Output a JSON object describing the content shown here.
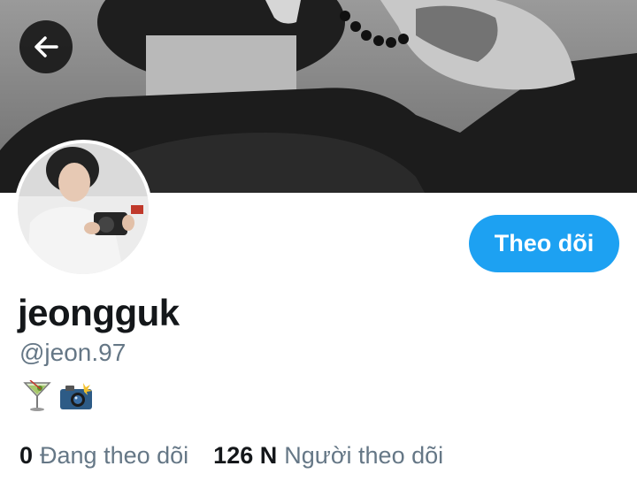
{
  "profile": {
    "display_name": "jeongguk",
    "handle": "@jeon.97",
    "follow_label": "Theo dõi",
    "bio_icons": [
      "cocktail-glass-icon",
      "camera-flash-icon"
    ]
  },
  "stats": {
    "following_count": "0",
    "following_label": "Đang theo dõi",
    "followers_count": "126 N",
    "followers_label": "Người theo dõi"
  },
  "colors": {
    "accent": "#1da1f2",
    "text_primary": "#14171a",
    "text_secondary": "#657786"
  }
}
